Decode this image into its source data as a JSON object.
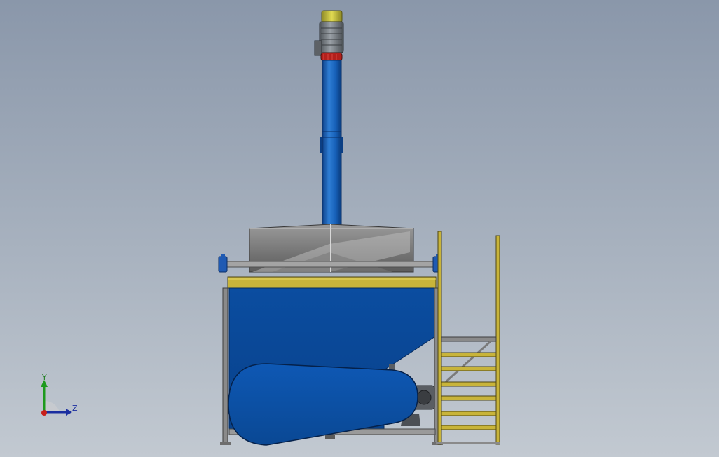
{
  "viewport": {
    "background_top": "#8a97aa",
    "background_bottom": "#c2c9d1"
  },
  "colors": {
    "hopper_blue": "#0a4a9a",
    "screw_tube_blue": "#1565c4",
    "frame_yellow": "#c8b43a",
    "steel_gray": "#8e8e8e",
    "motor_gray": "#6e7378",
    "motor_cap_yellow": "#c9c338",
    "flange_red": "#b3201c"
  },
  "triad": {
    "y_label": "Y",
    "z_label": "Z"
  }
}
